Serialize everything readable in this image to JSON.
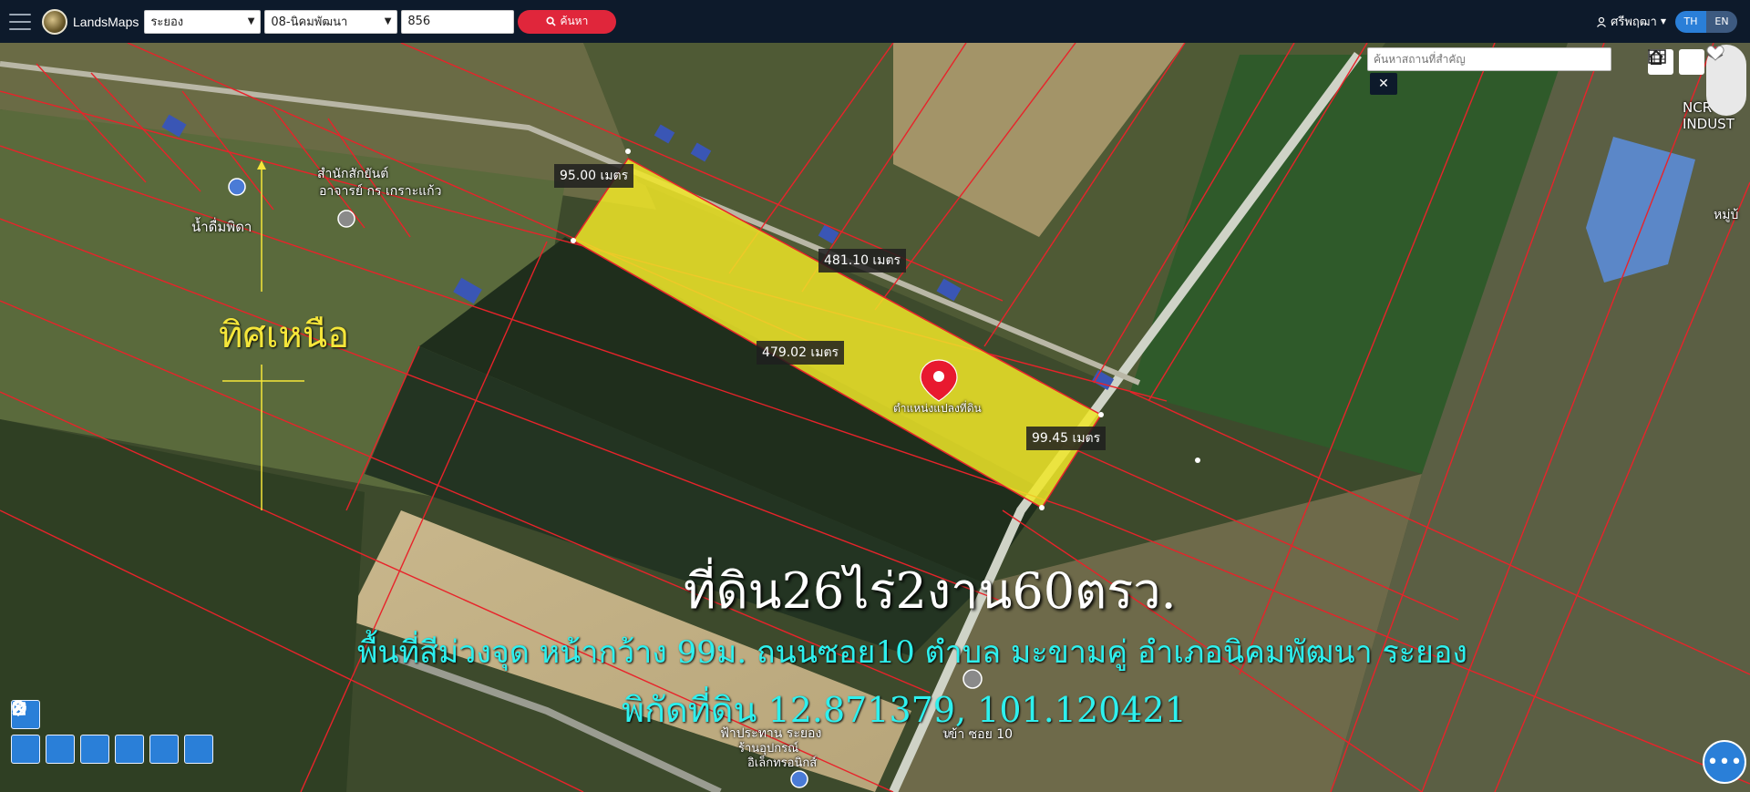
{
  "navbar": {
    "brand": "LandsMaps",
    "province": "ระยอง",
    "district": "08-นิคมพัฒนา",
    "parcel_number": "856",
    "search_label": "ค้นหา",
    "user_name": "ศรีพฤฒา",
    "lang_th": "TH",
    "lang_en": "EN"
  },
  "map": {
    "search_placeholder": "ค้นหาสถานที่สำคัญ",
    "close_label": "✕",
    "place_labels": {
      "shrine_line1": "สำนักสักยันต์",
      "shrine_line2": "อาจารย์ กร เกราะแก้ว",
      "water_shop": "น้ำดื่มพิดา",
      "industrial_line1": "NCR-IR",
      "industrial_line2": "INDUST",
      "village": "หมู่บ้",
      "pea_line1": "ฟ้าประทาน ระยอง",
      "pea_line2": "ร้านอุปกรณ์",
      "pea_line3": "อิเล็กทรอนิกส์",
      "soi_entrance": "เข้า ซอย 10",
      "parcel_position": "ตำแหน่งแปลงที่ดิน",
      "soi_prefix": "น"
    },
    "measurements": {
      "top": "95.00 เมตร",
      "north_side": "481.10 เมตร",
      "south_side": "479.02 เมตร",
      "east_side": "99.45 เมตร"
    },
    "north_label": "ทิศเหนือ",
    "title": "ที่ดิน26ไร่2งาน60ตรว.",
    "subtitle": "พื้นที่สีม่วงจุด หน้ากว้าง 99ม. ถนนซอย10 ตำบล มะขามคู่ อำเภอนิคมพัฒนา ระยอง",
    "coordinates": "พิกัดที่ดิน 12.871379, 101.120421"
  },
  "colors": {
    "navbar": "#0d1a2b",
    "search_button": "#e0263b",
    "parcel_fill": "#f0e628",
    "boundary_lines": "#e8232a",
    "subtitle_text": "#2ef0ee",
    "north_text": "#f5e63a",
    "tool_blue": "#2a7fd8"
  },
  "icons": {
    "menu": "hamburger-icon",
    "search": "magnifier-icon",
    "user": "user-icon",
    "home": "home-icon",
    "grid": "grid-icon",
    "layers": "layers-icon",
    "favorite": "heart-icon",
    "marker": "map-pin-icon",
    "eraser": "eraser-icon",
    "chat": "ellipsis-icon"
  }
}
